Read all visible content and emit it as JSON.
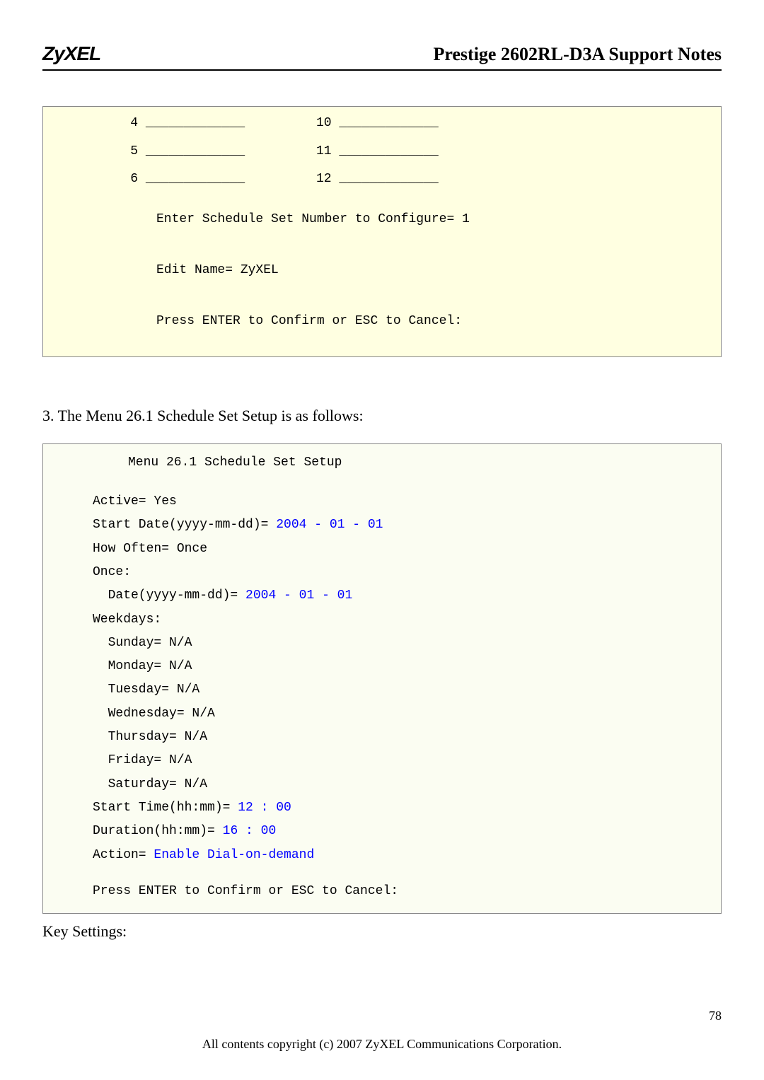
{
  "header": {
    "logo": "ZyXEL",
    "title": "Prestige 2602RL-D3A Support Notes"
  },
  "box1": {
    "rows": [
      {
        "left_num": "4",
        "left_fill": "_____________",
        "right_num": "10",
        "right_fill": " _____________"
      },
      {
        "left_num": "5",
        "left_fill": "_____________",
        "right_num": "11",
        "right_fill": " _____________"
      },
      {
        "left_num": "6",
        "left_fill": "_____________",
        "right_num": "12",
        "right_fill": " _____________"
      }
    ],
    "line1": "Enter Schedule Set Number to Configure= 1",
    "line2": "Edit Name= ZyXEL",
    "line3": "Press ENTER to Confirm or ESC to Cancel:"
  },
  "body_text": "3. The Menu 26.1 Schedule Set Setup is as follows:",
  "box2": {
    "title": "Menu 26.1 Schedule Set Setup",
    "active": "Active= Yes",
    "start_date_label": "Start Date(yyyy-mm-dd)= ",
    "start_date_value": "2004 - 01 - 01",
    "how_often": "How Often= Once",
    "once_label": "Once:",
    "once_date_label": "  Date(yyyy-mm-dd)= ",
    "once_date_value": "2004 - 01 - 01",
    "weekdays_label": "Weekdays:",
    "weekdays": [
      "  Sunday= N/A",
      "  Monday= N/A",
      "  Tuesday= N/A",
      "  Wednesday= N/A",
      "  Thursday= N/A",
      "  Friday= N/A",
      "  Saturday= N/A"
    ],
    "start_time_label": "Start Time(hh:mm)= ",
    "start_time_value": "12 : 00",
    "duration_label": "Duration(hh:mm)= ",
    "duration_value": "16 : 00",
    "action_label": "Action= ",
    "action_value": "Enable Dial-on-demand",
    "press": "Press ENTER to Confirm or ESC to Cancel:"
  },
  "key_settings": "Key Settings:",
  "page_num": "78",
  "footer": "All contents copyright (c) 2007 ZyXEL Communications Corporation."
}
